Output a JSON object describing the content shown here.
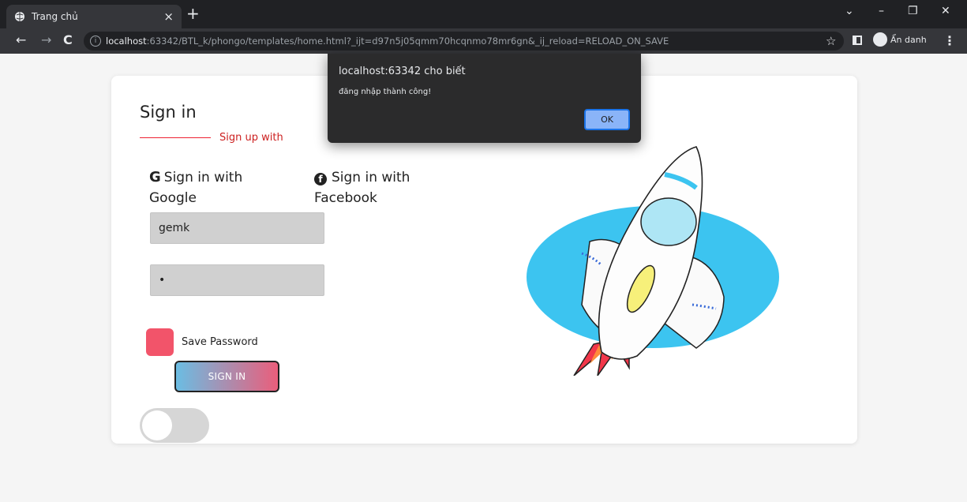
{
  "browser": {
    "tab_title": "Trang chủ",
    "tab_close": "×",
    "new_tab": "+",
    "url_host": "localhost",
    "url_rest": ":63342/BTL_k/phongo/templates/home.html?_ijt=d97n5j05qmm70hcqnmo78mr6gn&_ij_reload=RELOAD_ON_SAVE",
    "profile_label": "Ẩn danh",
    "nav_back": "←",
    "nav_forward": "→",
    "nav_reload": "C",
    "win_min": "–",
    "win_restore": "❐",
    "win_close": "✕",
    "tab_search": "⌄",
    "star": "☆",
    "menu": "⋮"
  },
  "dialog": {
    "title": "localhost:63342 cho biết",
    "message": "đăng nhập thành công!",
    "ok_label": "OK"
  },
  "form": {
    "title": "Sign in",
    "signup_link": "Sign up with",
    "google_label": "Sign in with Google",
    "facebook_label": "Sign in with Facebook",
    "username_value": "gemk",
    "password_value": "•",
    "save_password_label": "Save Password",
    "signin_button": "SIGN IN",
    "toggle_state": "off"
  },
  "colors": {
    "checkbox": "#f2546a",
    "accent_red": "#cc1f1f",
    "button_gradient_start": "#6bbde3",
    "button_gradient_end": "#ea5e7b",
    "rocket_backdrop": "#3cc4f0"
  },
  "icons": {
    "google": "G",
    "facebook": "f"
  }
}
